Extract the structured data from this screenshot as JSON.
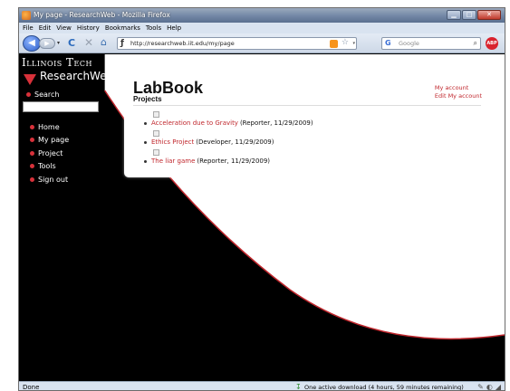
{
  "window": {
    "title": "My page - ResearchWeb - Mozilla Firefox",
    "buttons": {
      "minimize": "▁",
      "maximize": "□",
      "close": "✕"
    }
  },
  "menu": [
    "File",
    "Edit",
    "View",
    "History",
    "Bookmarks",
    "Tools",
    "Help"
  ],
  "nav": {
    "back_icon": "◀",
    "forward_icon": "▶",
    "dropdown_icon": "▾",
    "reload_icon": "C",
    "stop_icon": "✕",
    "home_icon": "⌂",
    "favicon": "ƒ",
    "url": "http://researchweb.iit.edu/my/page",
    "star_icon": "☆",
    "search_engine_icon": "G",
    "search_placeholder": "Google",
    "search_icon": "⌕",
    "addon_label": "ABP"
  },
  "site": {
    "logo_line1": "Illinois Tech",
    "logo_line2": "ResearchWeb",
    "search_label": "Search",
    "search_value": "",
    "nav_items": [
      "Home",
      "My page",
      "Project",
      "Tools",
      "Sign out"
    ]
  },
  "panel": {
    "title": "LabBook",
    "subtitle": "Projects",
    "account_links": [
      "My account",
      "Edit My account"
    ],
    "projects": [
      {
        "name": "Acceleration due to Gravity",
        "meta": "(Reporter, 11/29/2009)"
      },
      {
        "name": "Ethics Project",
        "meta": "(Developer, 11/29/2009)"
      },
      {
        "name": "The liar game",
        "meta": "(Reporter, 11/29/2009)"
      }
    ]
  },
  "status": {
    "left": "Done",
    "download": "One active download (4 hours, 59 minutes remaining)",
    "download_icon": "↧"
  },
  "colors": {
    "accent_red": "#c0272d",
    "page_bg": "#000000",
    "chrome": "#d9e3f0"
  }
}
